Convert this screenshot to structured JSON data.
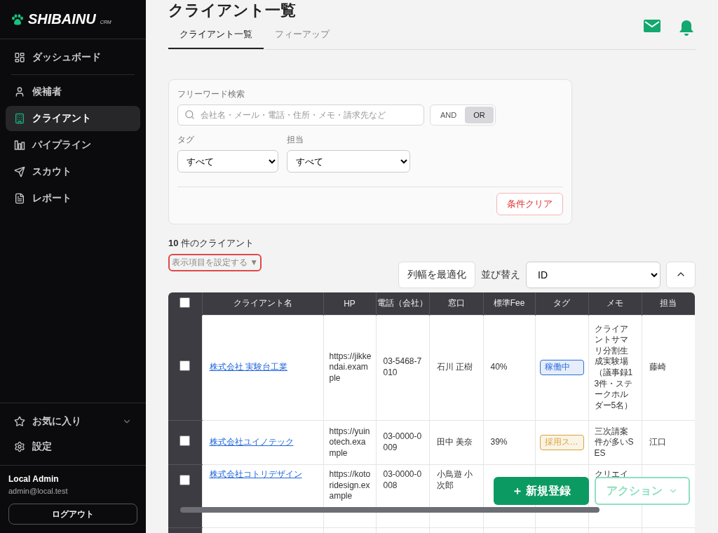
{
  "brand": {
    "name": "SHIBAINU",
    "sub": "CRM"
  },
  "sidebar": {
    "items": [
      {
        "label": "ダッシュボード",
        "selected": false
      },
      {
        "label": "候補者",
        "selected": false
      },
      {
        "label": "クライアント",
        "selected": true
      },
      {
        "label": "パイプライン",
        "selected": false
      },
      {
        "label": "スカウト",
        "selected": false
      },
      {
        "label": "レポート",
        "selected": false
      }
    ],
    "favorites": {
      "label": "お気に入り",
      "expanded": false
    },
    "settings": {
      "label": "設定"
    },
    "user": {
      "name": "Local Admin",
      "email": "admin@local.test"
    },
    "logout": "ログアウト"
  },
  "header": {
    "title": "クライアント一覧",
    "tabs": [
      {
        "label": "クライアント一覧",
        "selected": true
      },
      {
        "label": "フィーアップ",
        "selected": false
      }
    ]
  },
  "filters": {
    "keyword_label": "フリーワード検索",
    "placeholder": "会社名・メール・電話・住所・メモ・請求先など",
    "modes": [
      {
        "label": "AND",
        "selected": false
      },
      {
        "label": "OR",
        "selected": true
      }
    ],
    "tag_label": "タグ",
    "tag_value": "すべて",
    "owner_label": "担当",
    "owner_value": "すべて",
    "clear": "条件クリア"
  },
  "count": {
    "number": "10",
    "text": "件のクライアント"
  },
  "column_settings": "表示項目を設定する ▼",
  "toolbar": {
    "fit": "列幅を最適化",
    "sort_label": "並び替え",
    "sort_value": "ID"
  },
  "table": {
    "header_checked": false,
    "columns": [
      "クライアント名",
      "HP",
      "電話（会社）",
      "窓口",
      "標準Fee",
      "タグ",
      "メモ",
      "担当"
    ],
    "rows": [
      {
        "checked": false,
        "name": "株式会社 実験台工業",
        "hp": "https://jikkendai.example",
        "phone": "03-5468-7010",
        "contact": "石川 正樹",
        "fee": "40%",
        "tag": {
          "label": "稼働中",
          "color": "#2f6fdf"
        },
        "memo": "クライアントサマリ分割生成実験場（議事録13件・ステークホルダー5名）",
        "owner": "藤崎"
      },
      {
        "checked": false,
        "name": "株式会社ユイノテック",
        "hp": "https://yuinotech.example",
        "phone": "03-0000-0009",
        "contact": "田中 美奈",
        "fee": "39%",
        "tag": {
          "label": "採用ス…",
          "color": "#d9a53a"
        },
        "memo": "三次請案件が多いSES",
        "owner": "江口"
      },
      {
        "checked": false,
        "name": "株式会社コトリデザイン",
        "hp": "https://kotoridesign.example",
        "phone": "03-0000-0008",
        "contact": "小鳥遊 小次郎",
        "memo": "クリエイ"
      }
    ]
  },
  "actions": {
    "create": "＋ 新規登録",
    "menu": "アクション"
  }
}
